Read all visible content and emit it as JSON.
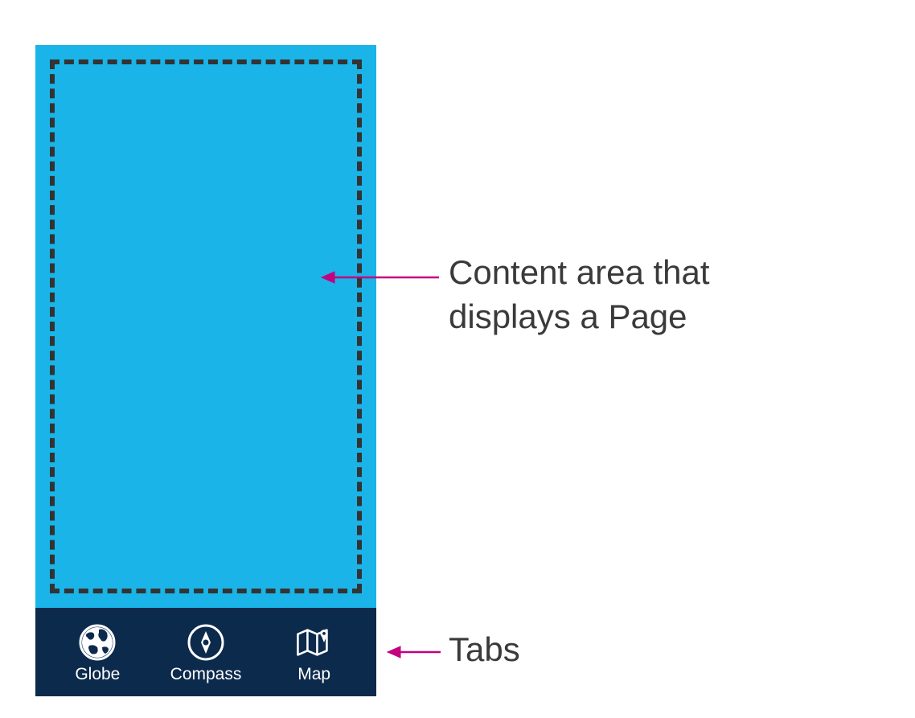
{
  "tabs": [
    {
      "label": "Globe",
      "icon": "globe-icon"
    },
    {
      "label": "Compass",
      "icon": "compass-icon"
    },
    {
      "label": "Map",
      "icon": "map-icon"
    }
  ],
  "annotations": {
    "content_line1": "Content area that",
    "content_line2_prefix": "displays a ",
    "content_line2_bold": "Page",
    "tabs": "Tabs"
  }
}
